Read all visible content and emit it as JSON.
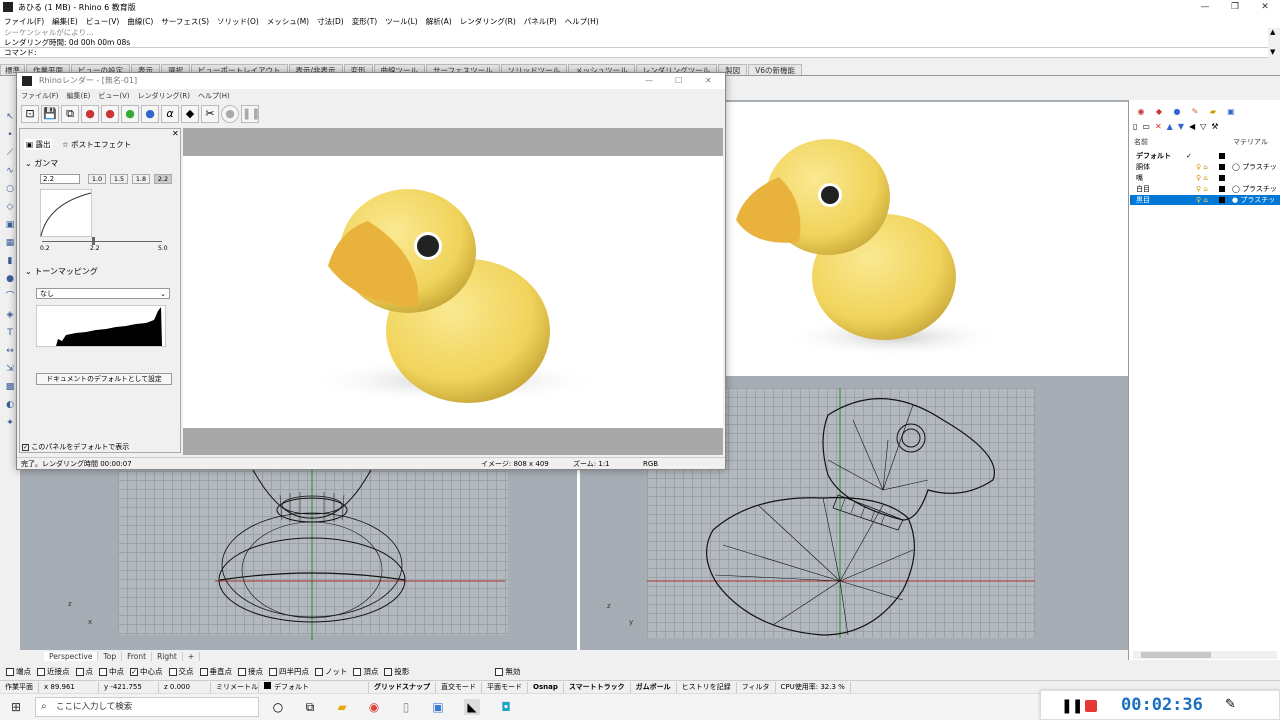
{
  "app": {
    "title": "あひる (1 MB) - Rhino 6 教育版",
    "menu": [
      "ファイル(F)",
      "編集(E)",
      "ビュー(V)",
      "曲線(C)",
      "サーフェス(S)",
      "ソリッド(O)",
      "メッシュ(M)",
      "寸法(D)",
      "変形(T)",
      "ツール(L)",
      "解析(A)",
      "レンダリング(R)",
      "パネル(P)",
      "ヘルプ(H)"
    ],
    "command_history": [
      "シーケンシャルがにより…",
      "レンダリング時間: 0d 00h 00m 08s"
    ],
    "command_prompt": "コマンド:",
    "toolbar_tabs": [
      "標準",
      "作業平面",
      "ビューの設定",
      "表示",
      "選択",
      "ビューポートレイアウト",
      "表示/非表示",
      "変形",
      "曲線ツール",
      "サーフェスツール",
      "ソリッドツール",
      "メッシュツール",
      "レンダリングツール",
      "製図",
      "V6の新機能"
    ]
  },
  "render_window": {
    "title": "Rhinoレンダー - [無名-01]",
    "menu": [
      "ファイル(F)",
      "編集(E)",
      "ビュー(V)",
      "レンダリング(R)",
      "ヘルプ(H)"
    ],
    "tabs": [
      "露出",
      "ポストエフェクト"
    ],
    "gamma": {
      "label": "ガンマ",
      "value": "2.2",
      "presets": [
        "1.0",
        "1.5",
        "1.8",
        "2.2"
      ],
      "axis": [
        "0.2",
        "2.2",
        "5.0"
      ]
    },
    "tonemapping": {
      "label": "トーンマッピング",
      "selected": "なし"
    },
    "set_default_button": "ドキュメントのデフォルトとして設定",
    "show_panel_checkbox": "このパネルをデフォルトで表示",
    "status": {
      "message": "完了。レンダリング時間 00:00:07",
      "image_size": "イメージ: 808 x 409",
      "zoom": "ズーム: 1:1",
      "channel": "RGB"
    }
  },
  "viewport_tabs": [
    "Perspective",
    "Top",
    "Front",
    "Right",
    "+"
  ],
  "layers": {
    "header_name": "名前",
    "header_material": "マテリアル",
    "rows": [
      {
        "name": "デフォルト",
        "current": "✓",
        "material": ""
      },
      {
        "name": "胴体",
        "current": "",
        "material": "プラスチッ"
      },
      {
        "name": "嘴",
        "current": "",
        "material": ""
      },
      {
        "name": "白目",
        "current": "",
        "material": "プラスチッ"
      },
      {
        "name": "黒目",
        "current": "",
        "material": "プラスチッ",
        "selected": true
      }
    ]
  },
  "osnaps": [
    {
      "label": "端点",
      "checked": false
    },
    {
      "label": "近接点",
      "checked": false
    },
    {
      "label": "点",
      "checked": false
    },
    {
      "label": "中点",
      "checked": false
    },
    {
      "label": "中心点",
      "checked": true
    },
    {
      "label": "交点",
      "checked": false
    },
    {
      "label": "垂直点",
      "checked": false
    },
    {
      "label": "接点",
      "checked": false
    },
    {
      "label": "四半円点",
      "checked": false
    },
    {
      "label": "ノット",
      "checked": false
    },
    {
      "label": "頂点",
      "checked": false
    },
    {
      "label": "投影",
      "checked": false
    },
    {
      "label": "無効",
      "checked": false
    }
  ],
  "status_bar": {
    "cplane": "作業平面",
    "x": "x 89.961",
    "y": "y -421.755",
    "z": "z 0.000",
    "units": "ミリメートル",
    "layer": "デフォルト",
    "toggles": [
      "グリッドスナップ",
      "直交モード",
      "平面モード",
      "Osnap",
      "スマートトラック",
      "ガムボール",
      "ヒストリを記録",
      "フィルタ"
    ],
    "cpu": "CPU使用率: 32.3 %"
  },
  "taskbar": {
    "search_placeholder": "ここに入力して検索"
  },
  "recorder": {
    "time": "00:02:36"
  },
  "axis_labels": {
    "top_vp": [
      "z",
      "x"
    ],
    "front_vp": [
      "z",
      "y"
    ]
  },
  "colors": {
    "accent": "#0078d7",
    "duck_body": "#f2d960",
    "duck_beak": "#e8b23c",
    "recorder_time": "#1b6fbf",
    "recorder_stop": "#e53935"
  }
}
